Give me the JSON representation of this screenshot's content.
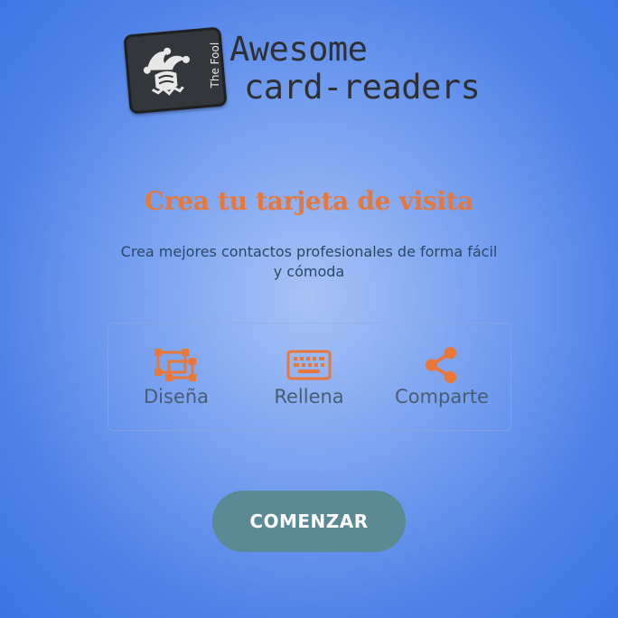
{
  "logo": {
    "card_label": "The Fool",
    "title_line1": "Awesome",
    "title_line2": "card-readers",
    "icon": "jester-icon"
  },
  "hero": {
    "title": "Crea tu tarjeta de visita",
    "subtitle": "Crea mejores contactos profesionales de forma fácil y cómoda"
  },
  "features": [
    {
      "label": "Diseña",
      "icon": "design-icon"
    },
    {
      "label": "Rellena",
      "icon": "keyboard-icon"
    },
    {
      "label": "Comparte",
      "icon": "share-icon"
    }
  ],
  "cta": {
    "label": "COMENZAR"
  },
  "colors": {
    "accent": "#e8783a",
    "button": "#5a8a94",
    "background": "#4f82e8",
    "text_dark": "#2a4766"
  }
}
